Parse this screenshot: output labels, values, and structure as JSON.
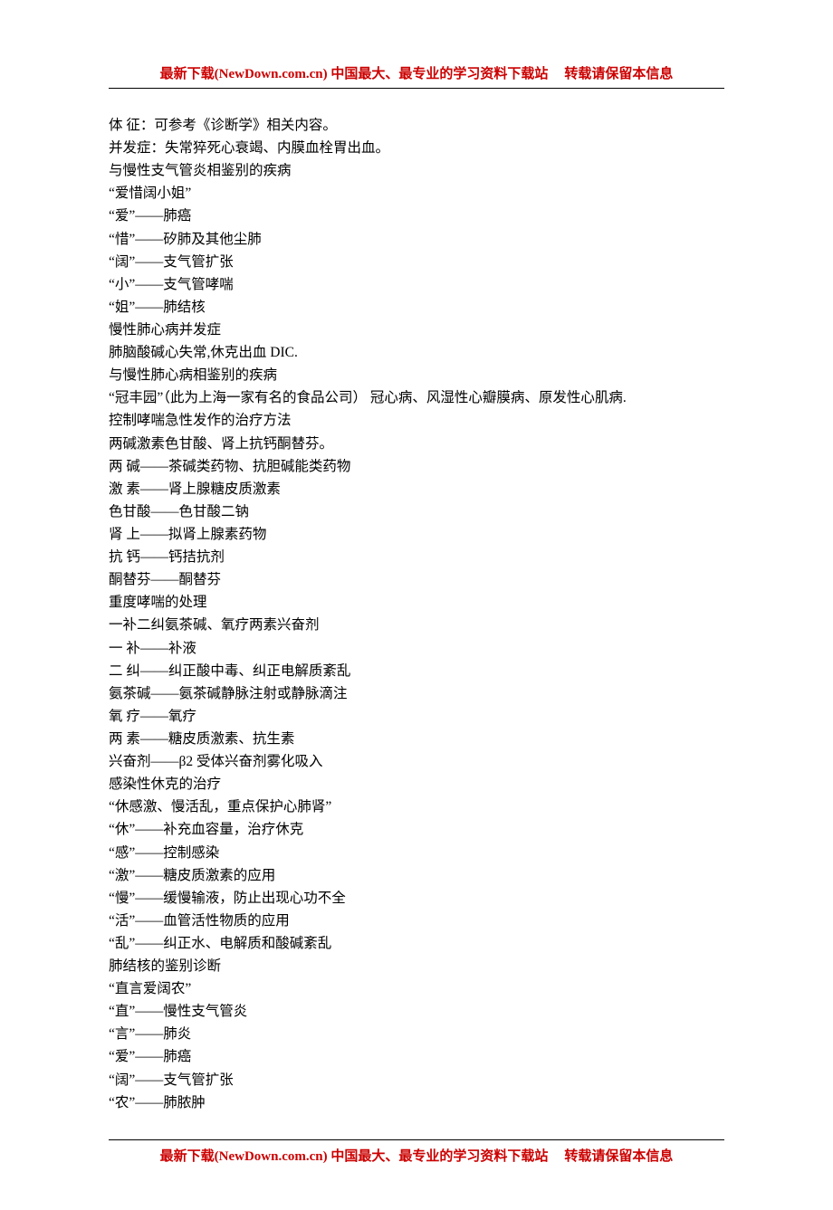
{
  "header": {
    "left": "最新下载(NewDown.com.cn) 中国最大、最专业的学习资料下载站",
    "right": "转载请保留本信息"
  },
  "footer": {
    "left": "最新下载(NewDown.com.cn) 中国最大、最专业的学习资料下载站",
    "right": "转载请保留本信息"
  },
  "lines": [
    "体 征：可参考《诊断学》相关内容。",
    "并发症：失常猝死心衰竭、内膜血栓胃出血。",
    "与慢性支气管炎相鉴别的疾病",
    "“爱惜阔小姐”",
    "“爱”——肺癌",
    "“惜”——矽肺及其他尘肺",
    "“阔”——支气管扩张",
    "“小”——支气管哮喘",
    "“姐”——肺结核",
    "慢性肺心病并发症",
    "肺脑酸碱心失常,休克出血 DIC.",
    "与慢性肺心病相鉴别的疾病",
    "“冠丰园”（此为上海一家有名的食品公司）   冠心病、风湿性心瓣膜病、原发性心肌病.",
    "控制哮喘急性发作的治疗方法",
    "两碱激素色甘酸、肾上抗钙酮替芬。",
    "两   碱——茶碱类药物、抗胆碱能类药物",
    "激   素——肾上腺糖皮质激素",
    "色甘酸——色甘酸二钠",
    "肾   上——拟肾上腺素药物",
    "抗   钙——钙拮抗剂",
    "酮替芬——酮替芬",
    "重度哮喘的处理",
    "一补二纠氨茶碱、氧疗两素兴奋剂",
    "一   补——补液",
    "二   纠——纠正酸中毒、纠正电解质紊乱",
    "氨茶碱——氨茶碱静脉注射或静脉滴注",
    "氧   疗——氧疗",
    "两   素——糖皮质激素、抗生素",
    "兴奋剂——β2 受体兴奋剂雾化吸入",
    "感染性休克的治疗",
    "“休感激、慢活乱，重点保护心肺肾”",
    "“休”——补充血容量，治疗休克",
    "“感”——控制感染",
    "“激”——糖皮质激素的应用",
    "“慢”——缓慢输液，防止出现心功不全",
    "“活”——血管活性物质的应用",
    "“乱”——纠正水、电解质和酸碱紊乱",
    "肺结核的鉴别诊断",
    "“直言爱阔农”",
    "“直”——慢性支气管炎",
    "“言”——肺炎",
    "“爱”——肺癌",
    "“阔”——支气管扩张",
    "“农”——肺脓肿"
  ]
}
